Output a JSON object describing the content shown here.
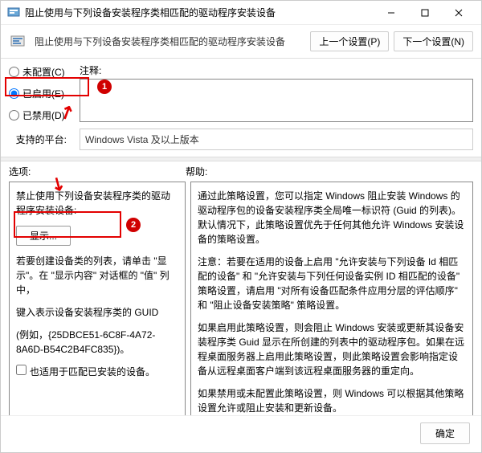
{
  "window": {
    "title": "阻止使用与下列设备安装程序类相匹配的驱动程序安装设备"
  },
  "header": {
    "title": "阻止使用与下列设备安装程序类相匹配的驱动程序安装设备",
    "prev_btn": "上一个设置(P)",
    "next_btn": "下一个设置(N)"
  },
  "radios": {
    "not_configured": "未配置(C)",
    "enabled": "已启用(E)",
    "disabled": "已禁用(D)"
  },
  "comment": {
    "label": "注释:"
  },
  "platform": {
    "label": "支持的平台:",
    "value": "Windows Vista 及以上版本"
  },
  "sections": {
    "options": "选项:",
    "help": "帮助:"
  },
  "options": {
    "title": "禁止使用下列设备安装程序类的驱动程序安装设备:",
    "show_btn": "显示...",
    "hint1": "若要创建设备类的列表，请单击 \"显示\"。在 \"显示内容\" 对话框的 \"值\" 列中，",
    "hint2": "键入表示设备安装程序类的 GUID",
    "hint3": "(例如，{25DBCE51-6C8F-4A72-8A6D-B54C2B4FC835})。",
    "checkbox_label": "也适用于匹配已安装的设备。"
  },
  "help": {
    "p1": "通过此策略设置，您可以指定 Windows 阻止安装 Windows 的驱动程序包的设备安装程序类全局唯一标识符 (Guid 的列表)。默认情况下，此策略设置优先于任何其他允许 Windows 安装设备的策略设置。",
    "p2": "注意：若要在适用的设备上启用 \"允许安装与下列设备 Id 相匹配的设备\" 和 \"允许安装与下列任何设备实例 ID 相匹配的设备\" 策略设置，请启用 \"对所有设备匹配条件应用分层的评估顺序\" 和 \"阻止设备安装策略\" 策略设置。",
    "p3": "如果启用此策略设置，则会阻止 Windows 安装或更新其设备安装程序类 Guid 显示在所创建的列表中的驱动程序包。如果在远程桌面服务器上启用此策略设置，则此策略设置会影响指定设备从远程桌面客户端到该远程桌面服务器的重定向。",
    "p4": "如果禁用或未配置此策略设置，则 Windows 可以根据其他策略设置允许或阻止安装和更新设备。"
  },
  "footer": {
    "ok": "确定"
  }
}
